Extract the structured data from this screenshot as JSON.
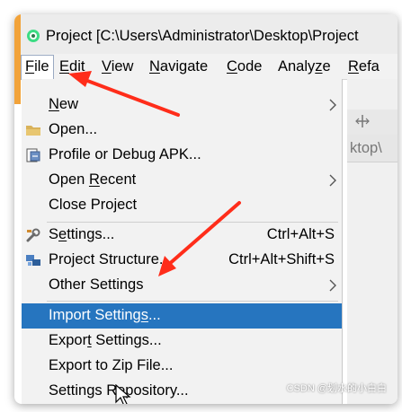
{
  "window": {
    "title": "Project [C:\\Users\\Administrator\\Desktop\\Project"
  },
  "menubar": {
    "items": [
      {
        "label": "File"
      },
      {
        "label": "Edit"
      },
      {
        "label": "View"
      },
      {
        "label": "Navigate"
      },
      {
        "label": "Code"
      },
      {
        "label": "Analyze"
      },
      {
        "label": "Refa"
      }
    ],
    "active": "File"
  },
  "background": {
    "tab_text": "ktop\\"
  },
  "file_menu": {
    "items": [
      {
        "label": "New",
        "submenu": true
      },
      {
        "label": "Open...",
        "icon": "folder-icon"
      },
      {
        "label": "Profile or Debug APK...",
        "icon": "debug-apk-icon"
      },
      {
        "label": "Open Recent",
        "submenu": true
      },
      {
        "label": "Close Project"
      },
      {
        "label": "Settings...",
        "shortcut": "Ctrl+Alt+S",
        "icon": "wrench-icon"
      },
      {
        "label": "Project Structure...",
        "shortcut": "Ctrl+Alt+Shift+S",
        "icon": "project-structure-icon"
      },
      {
        "label": "Other Settings",
        "submenu": true
      },
      {
        "label": "Import Settings...",
        "highlighted": true
      },
      {
        "label": "Export Settings..."
      },
      {
        "label": "Export to Zip File..."
      },
      {
        "label": "Settings Repository..."
      }
    ]
  },
  "colors": {
    "menu_highlight": "#2675bf",
    "annotation_arrow": "#ff2d1a",
    "accent_edge": "#f2a33a"
  },
  "watermark": "CSDN @划水的小白白"
}
